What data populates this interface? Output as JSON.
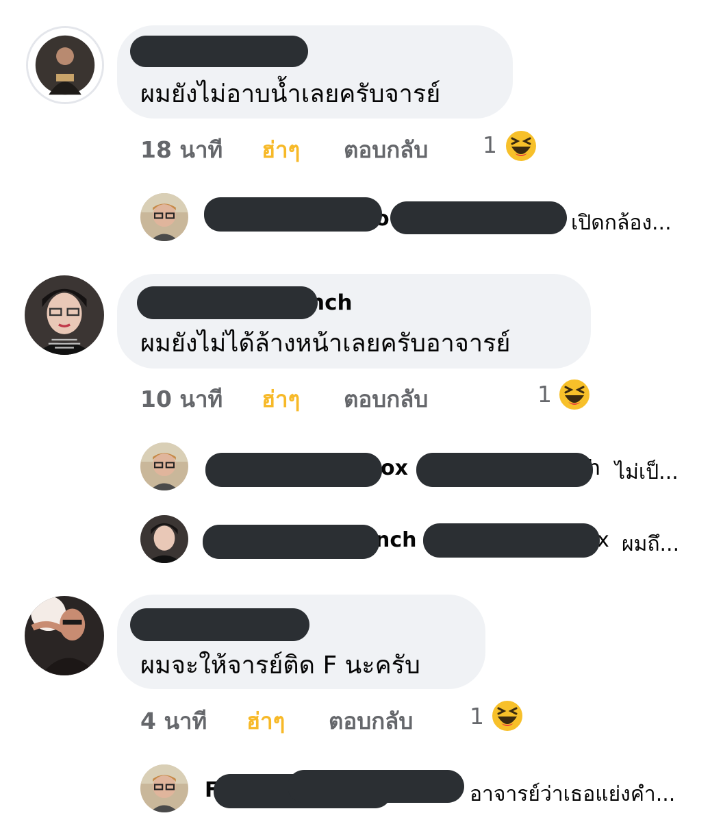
{
  "comments": [
    {
      "name_fragment": "",
      "text": "ผมยังไม่อาบน้ำเลยครับจารย์",
      "time": "18 นาที",
      "react_label": "ฮ่าๆ",
      "reply_label": "ตอบกลับ",
      "reaction_count": "1",
      "reaction_icon": "laughing-emoji",
      "replies": [
        {
          "name_fragment": "o",
          "text": "เปิดกล้อง..."
        }
      ]
    },
    {
      "name_fragment": "nch",
      "text": "ผมยังไม่ได้ล้างหน้าเลยครับอาจารย์",
      "time": "10 นาที",
      "react_label": "ฮ่าๆ",
      "reply_label": "ตอบกลับ",
      "reaction_count": "1",
      "reaction_icon": "laughing-emoji",
      "replies": [
        {
          "name_fragment": "ox",
          "mention_fragment": "h",
          "text": "ไม่เป็..."
        },
        {
          "name_fragment": "nch",
          "mention_fragment": "x",
          "text": "ผมถึ..."
        }
      ]
    },
    {
      "name_fragment": "",
      "text": "ผมจะให้จารย์ติด F นะครับ",
      "time": "4 นาที",
      "react_label": "ฮ่าๆ",
      "reply_label": "ตอบกลับ",
      "reaction_count": "1",
      "reaction_icon": "laughing-emoji",
      "replies": [
        {
          "name_fragment": "F",
          "text": "อาจารย์ว่าเธอแย่งคำ..."
        }
      ]
    }
  ],
  "colors": {
    "bubble_bg": "#f0f2f5",
    "haha": "#f7b928",
    "meta": "#65676b",
    "redaction": "#2b2f33"
  }
}
